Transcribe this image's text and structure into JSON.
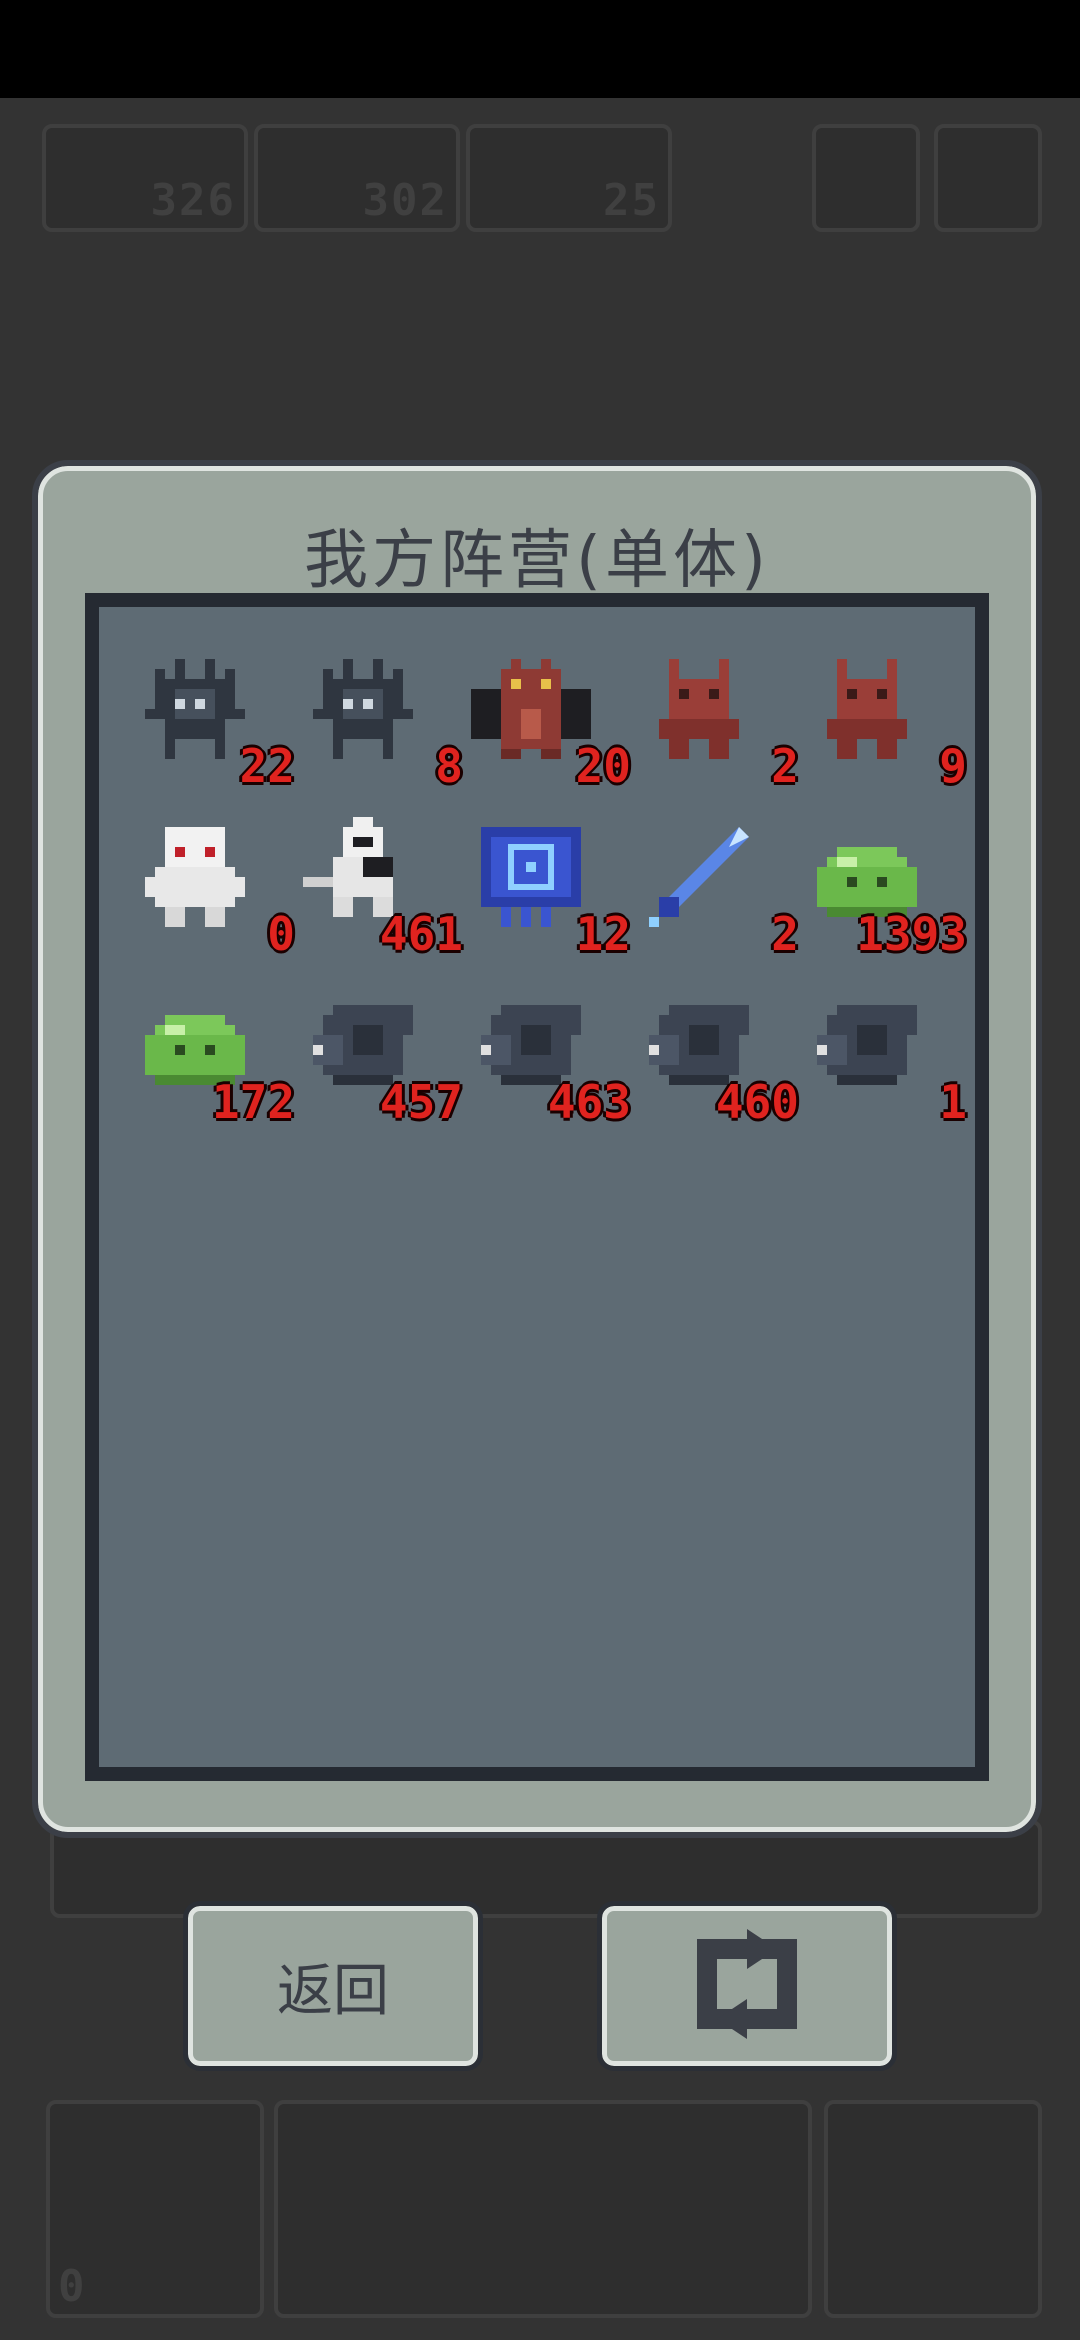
{
  "hud": {
    "top_counts": [
      "326",
      "302",
      "25"
    ],
    "bottom_count": "0"
  },
  "dialog": {
    "title": "我方阵营(单体)",
    "units": [
      {
        "icon": "dark-spider-robot-icon",
        "count": "22"
      },
      {
        "icon": "dark-spider-robot-icon",
        "count": "8"
      },
      {
        "icon": "red-dragon-icon",
        "count": "20"
      },
      {
        "icon": "red-imp-icon",
        "count": "2"
      },
      {
        "icon": "red-imp-icon",
        "count": "9"
      },
      {
        "icon": "white-ghost-icon",
        "count": "0"
      },
      {
        "icon": "white-knight-icon",
        "count": "461"
      },
      {
        "icon": "blue-banner-icon",
        "count": "12"
      },
      {
        "icon": "blue-sword-icon",
        "count": "2"
      },
      {
        "icon": "green-slime-icon",
        "count": "1393"
      },
      {
        "icon": "green-slime-icon",
        "count": "172"
      },
      {
        "icon": "gray-shark-icon",
        "count": "457"
      },
      {
        "icon": "gray-shark-icon",
        "count": "463"
      },
      {
        "icon": "gray-shark-icon",
        "count": "460"
      },
      {
        "icon": "gray-shark-icon",
        "count": "1"
      }
    ]
  },
  "buttons": {
    "back_label": "返回",
    "refresh_icon": "refresh-icon"
  }
}
